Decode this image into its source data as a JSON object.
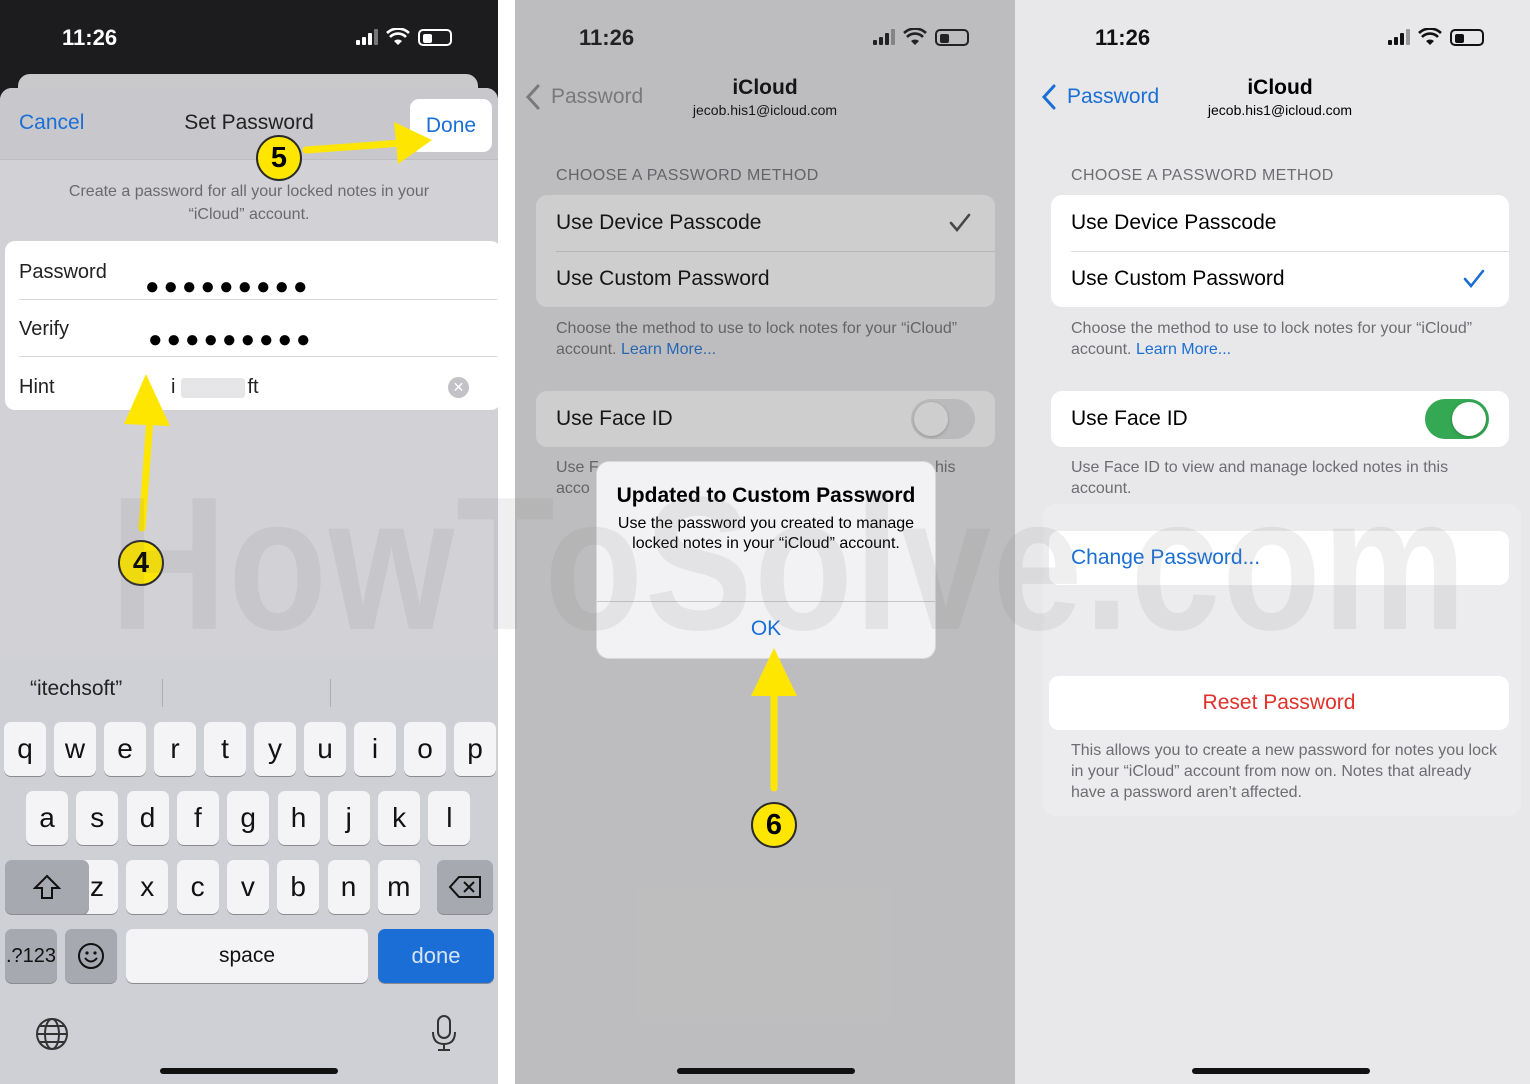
{
  "panel1": {
    "time": "11:26",
    "nav": {
      "cancel": "Cancel",
      "title": "Set Password",
      "done": "Done"
    },
    "description": "Create a password for all your locked notes in your “iCloud” account.",
    "fields": [
      {
        "label": "Password",
        "value": "●●●●●●●●●"
      },
      {
        "label": "Verify",
        "value": "●●●●●●●●●"
      },
      {
        "label": "Hint",
        "value_start": "i",
        "value_end": "ft"
      }
    ],
    "suggestion": "“itechsoft”",
    "keyboard": {
      "row1": [
        "q",
        "w",
        "e",
        "r",
        "t",
        "y",
        "u",
        "i",
        "o",
        "p"
      ],
      "row2": [
        "a",
        "s",
        "d",
        "f",
        "g",
        "h",
        "j",
        "k",
        "l"
      ],
      "row3": [
        "z",
        "x",
        "c",
        "v",
        "b",
        "n",
        "m"
      ],
      "numbers": ".?123",
      "space": "space",
      "done": "done"
    },
    "step_done": "5",
    "step_hint": "4"
  },
  "panel2": {
    "time": "11:26",
    "back": "Password",
    "title": "iCloud",
    "subtitle": "jecob.his1@icloud.com",
    "section": "CHOOSE A PASSWORD METHOD",
    "options": [
      "Use Device Passcode",
      "Use Custom Password"
    ],
    "foot_text": "Choose the method to use to lock notes for your “iCloud” account.",
    "learn_more": "Learn More...",
    "face_id": "Use Face ID",
    "face_foot_a": "Use F",
    "face_foot_b": "acco",
    "face_foot_c": "his",
    "alert": {
      "title": "Updated to Custom Password",
      "message": "Use the password you created to manage locked notes in your “iCloud” account.",
      "ok": "OK"
    },
    "step_ok": "6"
  },
  "panel3": {
    "time": "11:26",
    "back": "Password",
    "title": "iCloud",
    "subtitle": "jecob.his1@icloud.com",
    "section": "CHOOSE A PASSWORD METHOD",
    "options": [
      "Use Device Passcode",
      "Use Custom Password"
    ],
    "foot_text": "Choose the method to use to lock notes for your “iCloud” account.",
    "learn_more": "Learn More...",
    "face_id": "Use Face ID",
    "face_foot": "Use Face ID to view and manage locked notes in this account.",
    "change_password": "Change Password...",
    "reset_password": "Reset Password",
    "reset_foot": "This allows you to create a new password for notes you lock in your “iCloud” account from now on. Notes that already have a password aren’t affected."
  },
  "watermark": "HowToSolve.com",
  "colors": {
    "accent": "#1a6fd6",
    "destructive": "#e0302a",
    "toggle_on": "#34a853",
    "badge": "#ffe600"
  }
}
